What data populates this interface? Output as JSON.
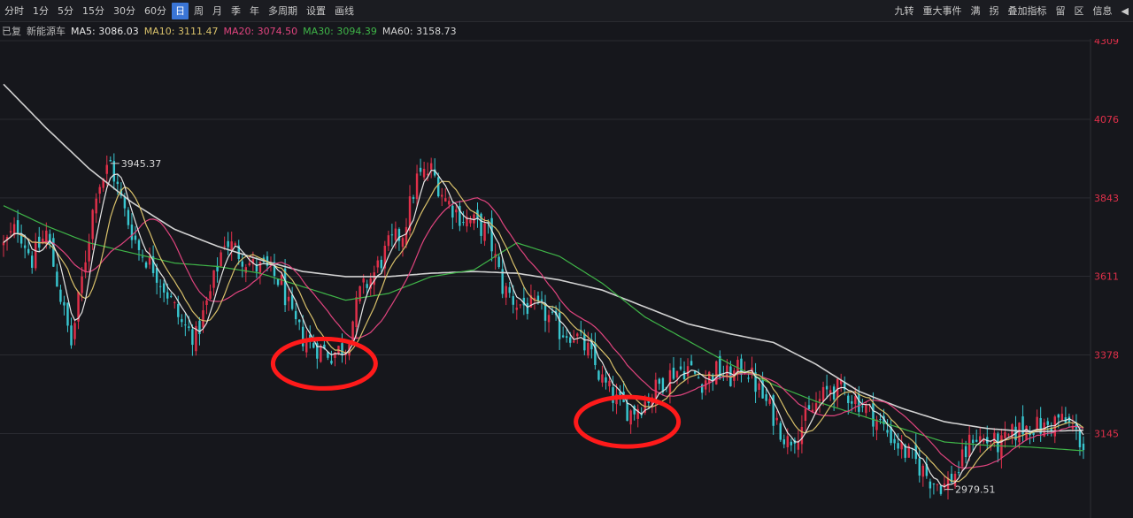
{
  "toolbar": {
    "periods": [
      "分时",
      "1分",
      "5分",
      "15分",
      "30分",
      "60分",
      "日",
      "周",
      "月",
      "季",
      "年",
      "多周期",
      "设置",
      "画线"
    ],
    "active_period": "日",
    "right_tools": [
      "九转",
      "重大事件",
      "满",
      "拐",
      "叠加指标",
      "留",
      "区",
      "信息"
    ]
  },
  "indicators": {
    "mode": "已复",
    "name": "新能源车",
    "ma5_label": "MA5:",
    "ma5_value": "3086.03",
    "ma10_label": "MA10:",
    "ma10_value": "3111.47",
    "ma20_label": "MA20:",
    "ma20_value": "3074.50",
    "ma30_label": "MA30:",
    "ma30_value": "3094.39",
    "ma60_label": "MA60:",
    "ma60_value": "3158.73"
  },
  "colors": {
    "up": "#e0304a",
    "down": "#38c6cf",
    "ma5": "#e6e6e6",
    "ma10": "#d8c06a",
    "ma20": "#e0447e",
    "ma30": "#3fb548",
    "ma60": "#d2d2d2",
    "highlight": "#ff1a1a"
  },
  "chart_data": {
    "type": "candlestick",
    "yticks": [
      "4309",
      "4076",
      "3843",
      "3611",
      "3378",
      "3145"
    ],
    "ylim": [
      2900,
      4309
    ],
    "grid": true,
    "annotations": [
      {
        "label": "3945.37",
        "type": "max",
        "x": 30,
        "price": 3945.37
      },
      {
        "label": "2979.51",
        "type": "min",
        "x": 264,
        "price": 2979.51
      }
    ],
    "highlight_circles": [
      {
        "x": 90,
        "price": 3352
      },
      {
        "x": 175,
        "price": 3180
      }
    ],
    "key_points": [
      [
        0,
        3700
      ],
      [
        4,
        3760
      ],
      [
        8,
        3660
      ],
      [
        12,
        3740
      ],
      [
        16,
        3550
      ],
      [
        19,
        3410
      ],
      [
        22,
        3600
      ],
      [
        26,
        3870
      ],
      [
        30,
        3945
      ],
      [
        34,
        3800
      ],
      [
        38,
        3690
      ],
      [
        42,
        3640
      ],
      [
        46,
        3560
      ],
      [
        50,
        3470
      ],
      [
        54,
        3430
      ],
      [
        58,
        3560
      ],
      [
        62,
        3720
      ],
      [
        66,
        3680
      ],
      [
        70,
        3640
      ],
      [
        74,
        3630
      ],
      [
        78,
        3590
      ],
      [
        81,
        3480
      ],
      [
        84,
        3430
      ],
      [
        88,
        3400
      ],
      [
        92,
        3380
      ],
      [
        96,
        3405
      ],
      [
        100,
        3560
      ],
      [
        104,
        3620
      ],
      [
        108,
        3700
      ],
      [
        112,
        3740
      ],
      [
        116,
        3900
      ],
      [
        120,
        3925
      ],
      [
        124,
        3840
      ],
      [
        128,
        3790
      ],
      [
        132,
        3770
      ],
      [
        136,
        3740
      ],
      [
        140,
        3580
      ],
      [
        144,
        3530
      ],
      [
        148,
        3520
      ],
      [
        152,
        3500
      ],
      [
        156,
        3450
      ],
      [
        160,
        3440
      ],
      [
        164,
        3390
      ],
      [
        168,
        3300
      ],
      [
        172,
        3240
      ],
      [
        176,
        3210
      ],
      [
        180,
        3240
      ],
      [
        184,
        3290
      ],
      [
        188,
        3330
      ],
      [
        192,
        3340
      ],
      [
        196,
        3300
      ],
      [
        200,
        3330
      ],
      [
        204,
        3310
      ],
      [
        208,
        3350
      ],
      [
        212,
        3270
      ],
      [
        216,
        3200
      ],
      [
        220,
        3120
      ],
      [
        224,
        3170
      ],
      [
        228,
        3230
      ],
      [
        232,
        3280
      ],
      [
        236,
        3270
      ],
      [
        240,
        3240
      ],
      [
        244,
        3200
      ],
      [
        248,
        3150
      ],
      [
        252,
        3100
      ],
      [
        256,
        3060
      ],
      [
        260,
        3010
      ],
      [
        264,
        2990
      ],
      [
        268,
        3040
      ],
      [
        272,
        3140
      ],
      [
        276,
        3120
      ],
      [
        280,
        3110
      ],
      [
        284,
        3150
      ],
      [
        288,
        3170
      ],
      [
        292,
        3160
      ],
      [
        296,
        3190
      ],
      [
        300,
        3160
      ],
      [
        303,
        3110
      ]
    ],
    "ma60_points": [
      [
        0,
        4180
      ],
      [
        12,
        4050
      ],
      [
        24,
        3930
      ],
      [
        36,
        3830
      ],
      [
        48,
        3750
      ],
      [
        60,
        3700
      ],
      [
        72,
        3660
      ],
      [
        84,
        3625
      ],
      [
        96,
        3610
      ],
      [
        108,
        3610
      ],
      [
        120,
        3620
      ],
      [
        132,
        3625
      ],
      [
        144,
        3620
      ],
      [
        156,
        3600
      ],
      [
        168,
        3570
      ],
      [
        180,
        3520
      ],
      [
        192,
        3470
      ],
      [
        204,
        3440
      ],
      [
        216,
        3415
      ],
      [
        228,
        3350
      ],
      [
        240,
        3270
      ],
      [
        252,
        3220
      ],
      [
        264,
        3180
      ],
      [
        276,
        3160
      ],
      [
        288,
        3150
      ],
      [
        303,
        3155
      ]
    ],
    "ma30_points": [
      [
        0,
        3820
      ],
      [
        12,
        3760
      ],
      [
        24,
        3710
      ],
      [
        36,
        3680
      ],
      [
        48,
        3650
      ],
      [
        60,
        3640
      ],
      [
        72,
        3620
      ],
      [
        84,
        3580
      ],
      [
        96,
        3540
      ],
      [
        108,
        3560
      ],
      [
        120,
        3610
      ],
      [
        132,
        3630
      ],
      [
        144,
        3710
      ],
      [
        156,
        3670
      ],
      [
        168,
        3590
      ],
      [
        180,
        3490
      ],
      [
        192,
        3420
      ],
      [
        204,
        3350
      ],
      [
        216,
        3290
      ],
      [
        228,
        3240
      ],
      [
        240,
        3200
      ],
      [
        252,
        3160
      ],
      [
        264,
        3120
      ],
      [
        276,
        3110
      ],
      [
        288,
        3105
      ],
      [
        303,
        3094
      ]
    ]
  }
}
